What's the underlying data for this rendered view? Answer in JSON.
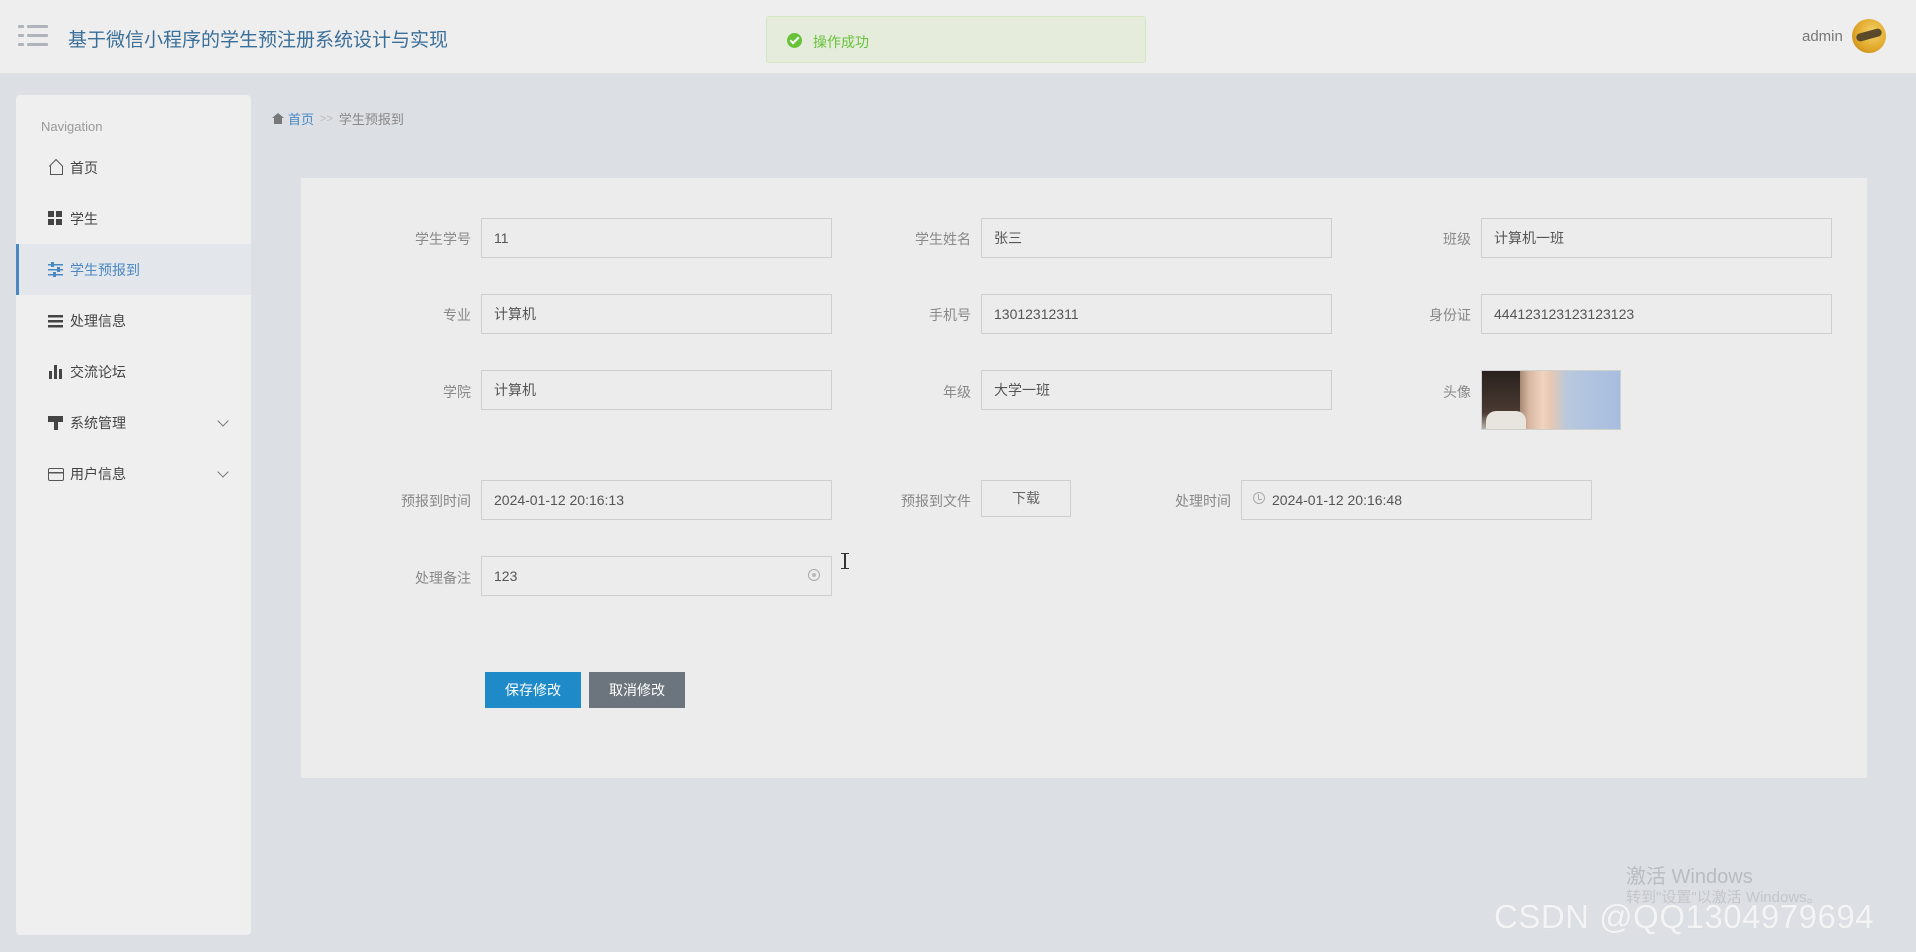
{
  "header": {
    "title": "基于微信小程序的学生预注册系统设计与实现",
    "toast": "操作成功",
    "user": "admin",
    "menu_icon": "hamburger-icon",
    "avatar_icon": "user-avatar"
  },
  "sidebar": {
    "heading": "Navigation",
    "items": [
      {
        "label": "首页",
        "icon": "home-icon"
      },
      {
        "label": "学生",
        "icon": "grid-icon"
      },
      {
        "label": "学生预报到",
        "icon": "sliders-icon",
        "active": true
      },
      {
        "label": "处理信息",
        "icon": "list-icon"
      },
      {
        "label": "交流论坛",
        "icon": "bar-chart-icon"
      },
      {
        "label": "系统管理",
        "icon": "brush-icon",
        "expandable": true
      },
      {
        "label": "用户信息",
        "icon": "card-icon",
        "expandable": true
      }
    ]
  },
  "breadcrumb": {
    "home": "首页",
    "separator": ">>",
    "current": "学生预报到"
  },
  "form": {
    "student_id": {
      "label": "学生学号",
      "value": "11"
    },
    "student_name": {
      "label": "学生姓名",
      "value": "张三"
    },
    "class": {
      "label": "班级",
      "value": "计算机一班"
    },
    "major": {
      "label": "专业",
      "value": "计算机"
    },
    "phone": {
      "label": "手机号",
      "value": "13012312311"
    },
    "id_card": {
      "label": "身份证",
      "value": "444123123123123123"
    },
    "college": {
      "label": "学院",
      "value": "计算机"
    },
    "grade": {
      "label": "年级",
      "value": "大学一班"
    },
    "avatar": {
      "label": "头像"
    },
    "prereg_time": {
      "label": "预报到时间",
      "value": "2024-01-12 20:16:13"
    },
    "prereg_file": {
      "label": "预报到文件",
      "button": "下载"
    },
    "process_time": {
      "label": "处理时间",
      "value": "2024-01-12 20:16:48"
    },
    "process_note": {
      "label": "处理备注",
      "value": "123"
    },
    "save_label": "保存修改",
    "cancel_label": "取消修改"
  },
  "watermarks": {
    "windows_line1": "激活 Windows",
    "windows_line2": "转到\"设置\"以激活 Windows。",
    "csdn": "CSDN @QQ1304979694"
  },
  "colors": {
    "accent": "#4a88c4",
    "save_button": "#1f8ac8",
    "cancel_button": "#6c757d",
    "success": "#67c23a"
  }
}
